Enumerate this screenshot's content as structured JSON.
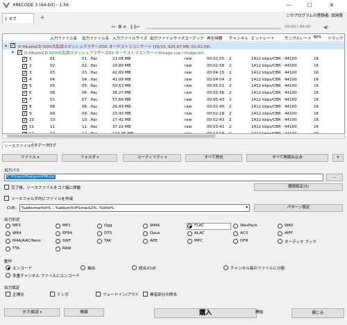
{
  "app": {
    "title": "XRECODE 3 (64-bit) - 1.56",
    "registration": "このプログラムの登録者: 試用版"
  },
  "tabs": [
    {
      "label": "1 タブ"
    },
    {
      "label": "+"
    }
  ],
  "transport": {
    "time": "00:00 / 00:00"
  },
  "columns": [
    "入力ファイル名",
    "出力ファイル名",
    "入力ファイルサイズ",
    "出力ファイルサイズ",
    "コーデック",
    "再生時間",
    "チャンネル",
    "ビットレート",
    "サンプルレート",
    "BPS",
    "トラック"
  ],
  "tree": {
    "root": "D:¥AudioCD ISO¥大乱闘スマッシュブラザーズDX オーケストラコンサート (15/15, 625.67 MB, 01:01:59)",
    "cue": "D:¥AudioCD ISO¥大乱闘スマッシュブラザーズDX オーケストラコンサート¥Image.cue / Image.bin"
  },
  "tracks": [
    {
      "num": "1",
      "in": "01.",
      "out": "01. .flac",
      "size": "21.08 MB",
      "codec": "raw",
      "time": "00:02:05",
      "ch": "2",
      "br": "1412 kbps/CBR",
      "sr": "44100",
      "bps": "16"
    },
    {
      "num": "2",
      "in": "02.",
      "out": "02. .flac",
      "size": "29.89 MB",
      "codec": "raw",
      "time": "00:02:58",
      "ch": "2",
      "br": "1412 kbps/CBR",
      "sr": "44100",
      "bps": "16"
    },
    {
      "num": "3",
      "in": "03.",
      "out": "03. .flac",
      "size": "42.89 MB",
      "codec": "raw",
      "time": "00:04:15",
      "ch": "2",
      "br": "1412 kbps/CBR",
      "sr": "44100",
      "bps": "16"
    },
    {
      "num": "4",
      "in": "04.",
      "out": "04. .flac",
      "size": "41.08 MB",
      "codec": "raw",
      "time": "00:04:04",
      "ch": "2",
      "br": "1412 kbps/CBR",
      "sr": "44100",
      "bps": "16"
    },
    {
      "num": "5",
      "in": "05.",
      "out": "05. .flac",
      "size": "50.63 MB",
      "codec": "raw",
      "time": "00:05:01",
      "ch": "2",
      "br": "1412 kbps/CBR",
      "sr": "44100",
      "bps": "16"
    },
    {
      "num": "6",
      "in": "06.",
      "out": "06. .flac",
      "size": "36.27 MB",
      "codec": "raw",
      "time": "00:03:36",
      "ch": "2",
      "br": "1412 kbps/CBR",
      "sr": "44100",
      "bps": "16"
    },
    {
      "num": "7",
      "in": "07.",
      "out": "07. .flac",
      "size": "57.66 MB",
      "codec": "raw",
      "time": "00:05:43",
      "ch": "2",
      "br": "1412 kbps/CBR",
      "sr": "44100",
      "bps": "16"
    },
    {
      "num": "8",
      "in": "08.",
      "out": "08. .flac",
      "size": "26.93 MB",
      "codec": "raw",
      "time": "00:02:40",
      "ch": "2",
      "br": "1412 kbps/CBR",
      "sr": "44100",
      "bps": "16"
    },
    {
      "num": "9",
      "in": "09.",
      "out": "09. .flac",
      "size": "23.43 MB",
      "codec": "raw",
      "time": "00:02:19",
      "ch": "2",
      "br": "1412 kbps/CBR",
      "sr": "44100",
      "bps": "16"
    },
    {
      "num": "10",
      "in": "10.",
      "out": "10. .flac",
      "size": "27.42 MB",
      "codec": "raw",
      "time": "00:02:43",
      "ch": "2",
      "br": "1412 kbps/CBR",
      "sr": "44100",
      "bps": "16"
    },
    {
      "num": "11",
      "in": "11.",
      "out": "11. .flac",
      "size": "37.22 MB",
      "codec": "raw",
      "time": "00:03:41",
      "ch": "2",
      "br": "1412 kbps/CBR",
      "sr": "44100",
      "bps": "16"
    },
    {
      "num": "12",
      "in": "12.",
      "out": "12. .flac",
      "size": "144.35 MB",
      "codec": "raw",
      "time": "00:14:18",
      "ch": "2",
      "br": "1412 kbps/CBR",
      "sr": "44100",
      "bps": "16"
    }
  ],
  "panel_tabs": [
    "ソースファイル",
    "メタデータ",
    "ログ"
  ],
  "toolbar": {
    "file": "ファイル",
    "folder": "フォルダ",
    "utility": "ユーティリティ",
    "remove_all": "すべて除去",
    "reload_all": "すべて再読み込み"
  },
  "output": {
    "path_label": "出力パス",
    "path_value": "C:¥Users¥katgum¥Music",
    "browse": "...",
    "move_source": "完了後、ソースファイルをゴミ箱に移動",
    "env_settings": "環境設定(S)",
    "create_in_source": "ソースフォルダ内にファイルを作成",
    "cue_label": "CUE:",
    "cue_pattern": "%albumartist% - %album%¥%track2%. %title%",
    "pattern_settings": "パターン設定"
  },
  "formats": {
    "label": "出力形式",
    "items": [
      "MP3",
      "MP2",
      "Ogg",
      "WMA",
      "FLAC",
      "WavPack",
      "WAV",
      "W64",
      "RF64",
      "DTS",
      "Opus",
      "ALAC",
      "AC3",
      "AIFF",
      "M4A/AAC/Nero",
      "SWF",
      "TAK",
      "APE",
      "MPC",
      "OFR",
      "オーディオ ブック",
      "TTA",
      "RAW"
    ],
    "selected": "FLAC"
  },
  "action": {
    "label": "動作",
    "items": [
      "エンコード",
      "抽出",
      "統合/CUE",
      "チャンネル毎のファイルに分割",
      "多重チャンネル ファイルにエンコード"
    ],
    "selected": "エンコード"
  },
  "out_settings": {
    "label": "出力設定",
    "items": [
      "正規化",
      "テンポ",
      "フェードイン/アウト",
      "無音部分の除去"
    ]
  },
  "bottom": {
    "tabs_settings": "タブ/設定",
    "info": "情報",
    "buy": "購入",
    "start": "開始",
    "close": "閉じる"
  }
}
